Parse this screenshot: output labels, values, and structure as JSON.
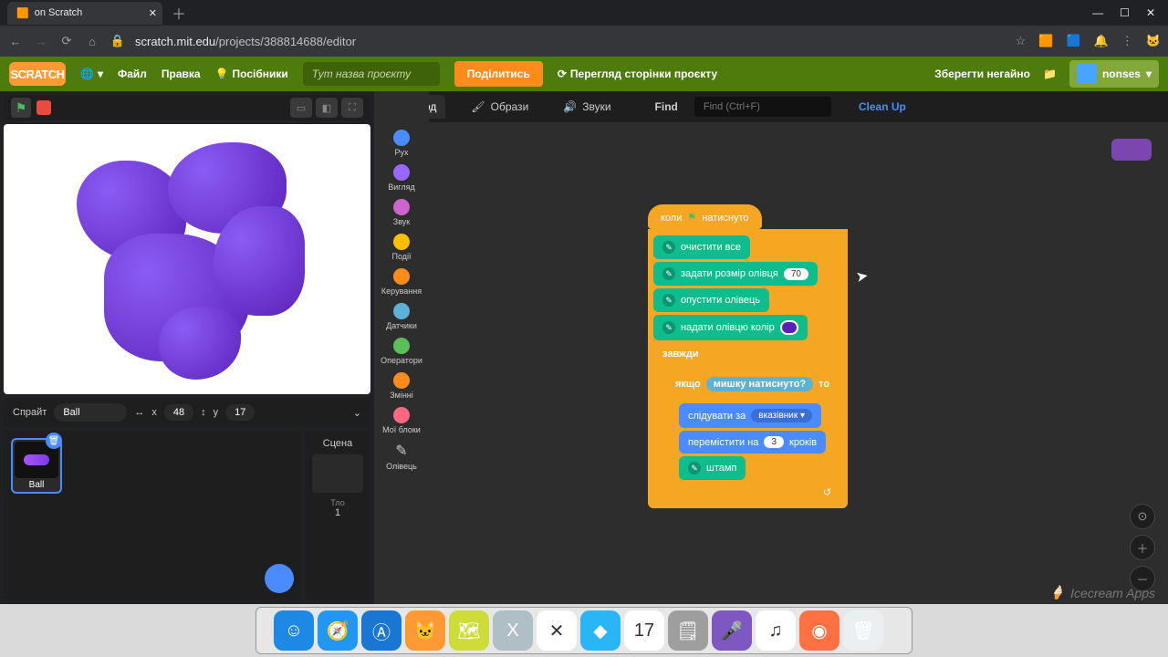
{
  "browser": {
    "tab_title": "on Scratch",
    "url_host": "scratch.mit.edu",
    "url_path": "/projects/388814688/editor"
  },
  "win": {
    "min": "—",
    "max": "☐",
    "close": "✕"
  },
  "menu": {
    "logo": "SCRATCH",
    "globe": "🌐",
    "file": "Файл",
    "edit": "Правка",
    "tutorials": "Посібники",
    "title_placeholder": "Тут назва проєкту",
    "share": "Поділитись",
    "see_page": "Перегляд сторінки проєкту",
    "save_now": "Зберегти негайно",
    "folder": "📁",
    "user": "nonses"
  },
  "tabs": {
    "code": "Код",
    "costumes": "Образи",
    "sounds": "Звуки",
    "find": "Find",
    "find_ph": "Find (Ctrl+F)",
    "cleanup": "Clean Up"
  },
  "categories": [
    {
      "c": "#4a8cff",
      "l": "Рух"
    },
    {
      "c": "#9966ff",
      "l": "Вигляд"
    },
    {
      "c": "#cf63cf",
      "l": "Звук"
    },
    {
      "c": "#ffbf00",
      "l": "Події"
    },
    {
      "c": "#ff8c1a",
      "l": "Керування"
    },
    {
      "c": "#5cb1d6",
      "l": "Датчики"
    },
    {
      "c": "#59c059",
      "l": "Оператори"
    },
    {
      "c": "#ff8c1a",
      "l": "Змінні"
    },
    {
      "c": "#ff6680",
      "l": "Мої блоки"
    },
    {
      "c": "#0fbd8c",
      "l": "Олівець"
    }
  ],
  "sprite": {
    "label": "Спрайт",
    "name": "Ball",
    "x_lbl": "x",
    "x": "48",
    "y_lbl": "y",
    "y": "17"
  },
  "stage": {
    "label": "Сцена",
    "backdrops_lbl": "Тло",
    "backdrops": "1"
  },
  "script": {
    "hat_pre": "коли",
    "hat_post": "натиснуто",
    "erase": "очистити все",
    "pensize": "задати розмір олівця",
    "pensize_val": "70",
    "pendown": "опустити олівець",
    "pencolor": "надати олівцю колір",
    "forever": "завжди",
    "if": "якщо",
    "then": "то",
    "mousedown": "мишку натиснуто?",
    "goto": "слідувати за",
    "goto_arg": "вказівник ▾",
    "move": "перемістити на",
    "move_val": "3",
    "move_suf": "кроків",
    "stamp": "штамп"
  },
  "watermark": "Icecream Apps",
  "dock": [
    {
      "bg": "#1e88e5",
      "t": "☺"
    },
    {
      "bg": "#2196f3",
      "t": "🧭"
    },
    {
      "bg": "#1976d2",
      "t": "Ⓐ"
    },
    {
      "bg": "#ff9933",
      "t": "🐱"
    },
    {
      "bg": "#cddc39",
      "t": "🗺"
    },
    {
      "bg": "#b0bec5",
      "t": "X"
    },
    {
      "bg": "#ffffff",
      "t": "✕"
    },
    {
      "bg": "#29b6f6",
      "t": "◆"
    },
    {
      "bg": "#ffffff",
      "t": "17"
    },
    {
      "bg": "#9e9e9e",
      "t": "🗒"
    },
    {
      "bg": "#7e57c2",
      "t": "🎤"
    },
    {
      "bg": "#ffffff",
      "t": "♫"
    },
    {
      "bg": "#ff7043",
      "t": "◉"
    },
    {
      "bg": "#eceff1",
      "t": "🗑"
    }
  ]
}
